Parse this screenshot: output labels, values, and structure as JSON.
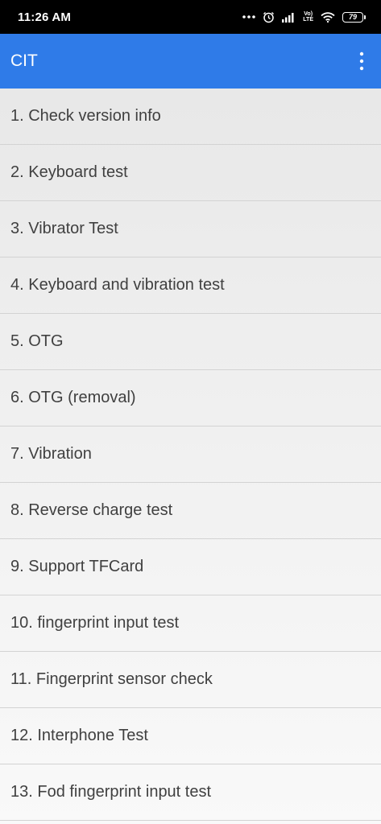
{
  "status_bar": {
    "time": "11:26 AM",
    "icons": [
      "more-dots-icon",
      "alarm-icon",
      "signal-icon",
      "volte-icon",
      "wifi-icon",
      "battery-icon"
    ],
    "volte_line1": "Vo)",
    "volte_line2": "LTE",
    "battery_level": "79"
  },
  "app_bar": {
    "title": "CIT",
    "background_color": "#2f7be8",
    "menu_icon": "more-vert-icon"
  },
  "test_list": {
    "items": [
      {
        "label": "1. Check version info"
      },
      {
        "label": "2. Keyboard test"
      },
      {
        "label": "3. Vibrator Test"
      },
      {
        "label": "4. Keyboard and vibration test"
      },
      {
        "label": "5. OTG"
      },
      {
        "label": "6. OTG (removal)"
      },
      {
        "label": "7. Vibration"
      },
      {
        "label": "8. Reverse charge test"
      },
      {
        "label": "9. Support TFCard"
      },
      {
        "label": "10. fingerprint input test"
      },
      {
        "label": "11. Fingerprint sensor check"
      },
      {
        "label": "12. Interphone Test"
      },
      {
        "label": "13. Fod fingerprint input test"
      }
    ]
  }
}
